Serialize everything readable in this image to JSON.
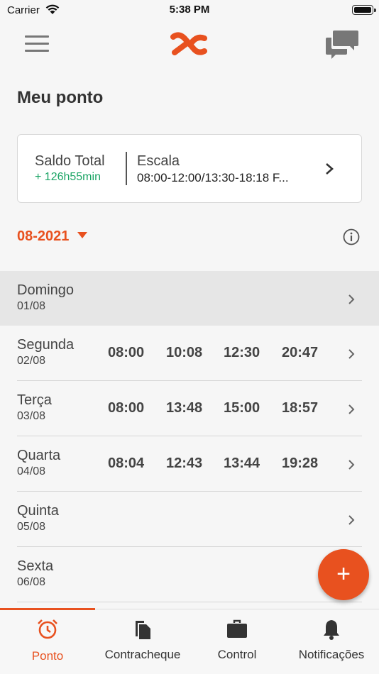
{
  "status_bar": {
    "carrier": "Carrier",
    "time": "5:38 PM"
  },
  "header": {
    "title": "Meu ponto"
  },
  "summary": {
    "saldo_label": "Saldo Total",
    "saldo_value": "+ 126h55min",
    "escala_label": "Escala",
    "escala_value": "08:00-12:00/13:30-18:18 F..."
  },
  "month": {
    "value": "08-2021"
  },
  "days": [
    {
      "name": "Domingo",
      "date": "01/08",
      "punches": []
    },
    {
      "name": "Segunda",
      "date": "02/08",
      "punches": [
        "08:00",
        "10:08",
        "12:30",
        "20:47"
      ]
    },
    {
      "name": "Terça",
      "date": "03/08",
      "punches": [
        "08:00",
        "13:48",
        "15:00",
        "18:57"
      ]
    },
    {
      "name": "Quarta",
      "date": "04/08",
      "punches": [
        "08:04",
        "12:43",
        "13:44",
        "19:28"
      ]
    },
    {
      "name": "Quinta",
      "date": "05/08",
      "punches": []
    },
    {
      "name": "Sexta",
      "date": "06/08",
      "punches": []
    }
  ],
  "fab": {
    "label": "+"
  },
  "tabs": [
    {
      "label": "Ponto",
      "icon": "alarm-clock-icon"
    },
    {
      "label": "Contracheque",
      "icon": "documents-icon"
    },
    {
      "label": "Control",
      "icon": "briefcase-icon"
    },
    {
      "label": "Notificações",
      "icon": "bell-icon"
    }
  ],
  "colors": {
    "accent": "#e8511f",
    "positive": "#1aa464",
    "text": "#333333"
  }
}
